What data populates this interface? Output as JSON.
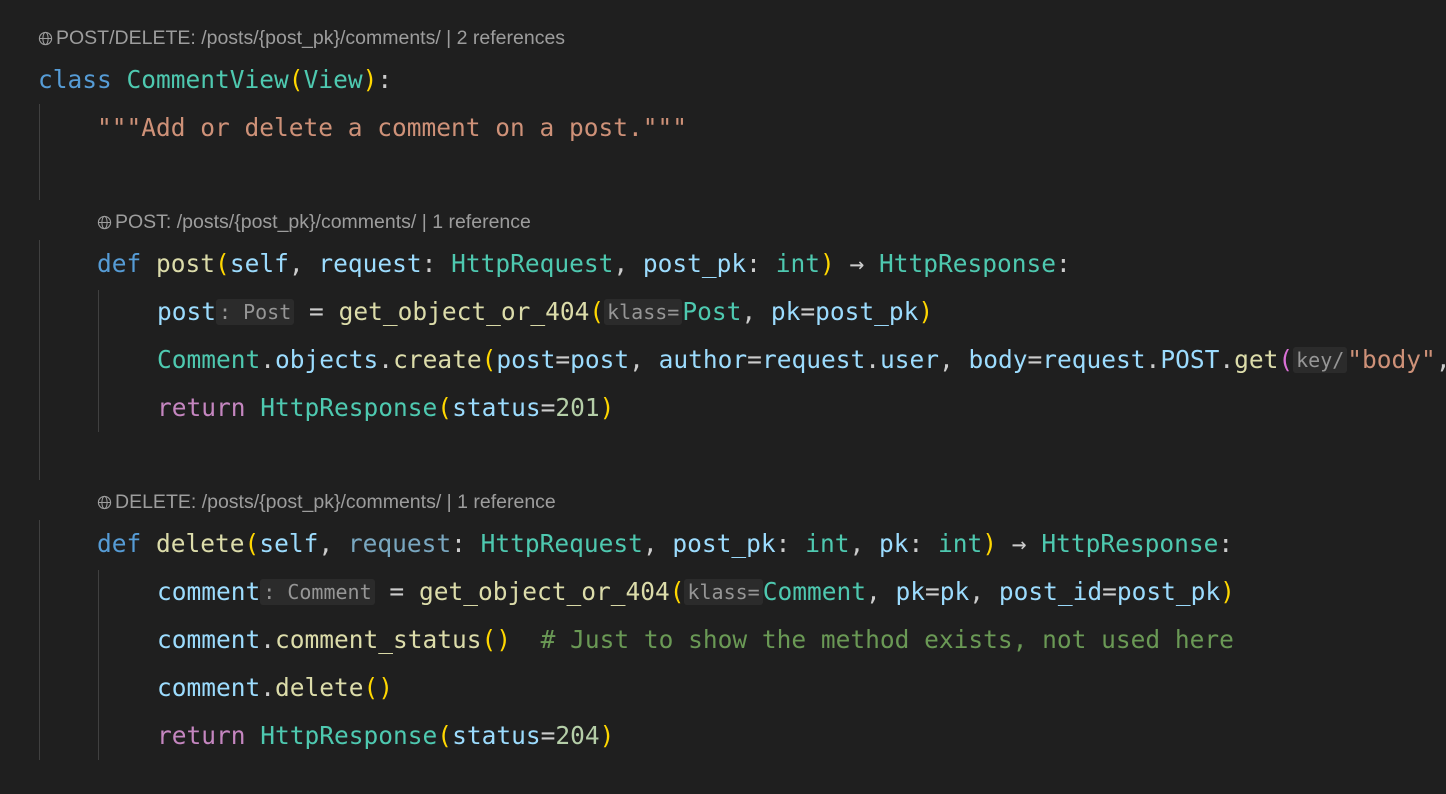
{
  "codelens": {
    "class_lens": "POST/DELETE: /posts/{post_pk}/comments/ | 2 references",
    "post_lens": "POST: /posts/{post_pk}/comments/ | 1 reference",
    "delete_lens": "DELETE: /posts/{post_pk}/comments/ | 1 reference"
  },
  "code": {
    "kw_class": "class",
    "class_name": "CommentView",
    "base_class": "View",
    "docstring": "\"\"\"Add or delete a comment on a post.\"\"\"",
    "kw_def": "def",
    "fn_post": "post",
    "fn_delete": "delete",
    "self": "self",
    "request": "request",
    "HttpRequest": "HttpRequest",
    "post_pk": "post_pk",
    "int": "int",
    "arrow": "→",
    "HttpResponse": "HttpResponse",
    "post": "post",
    "post_hint": ": Post",
    "get_object_or_404": "get_object_or_404",
    "klass_hint": "klass=",
    "Post": "Post",
    "pk": "pk",
    "Comment": "Comment",
    "objects": "objects",
    "create": "create",
    "author": "author",
    "body": "body",
    "user": "user",
    "POST": "POST",
    "get": "get",
    "key_hint": "key/",
    "body_str": "\"body\"",
    "kw_return": "return",
    "status": "status",
    "num_201": "201",
    "num_204": "204",
    "comment": "comment",
    "comment_hint": ": Comment",
    "post_id": "post_id",
    "comment_status": "comment_status",
    "comment_text": "# Just to show the method exists, not used here",
    "delete_call": "delete"
  },
  "colors": {
    "background": "#1f1f1f",
    "keyword": "#569cd6",
    "control": "#c586c0",
    "class": "#4ec9b0",
    "function": "#dcdcaa",
    "variable": "#9cdcfe",
    "string": "#ce9178",
    "number": "#b5cea8",
    "comment": "#6a9955",
    "bracket_1": "#ffd700",
    "bracket_2": "#da70d6"
  },
  "icons": {
    "codelens": "globe-icon"
  }
}
